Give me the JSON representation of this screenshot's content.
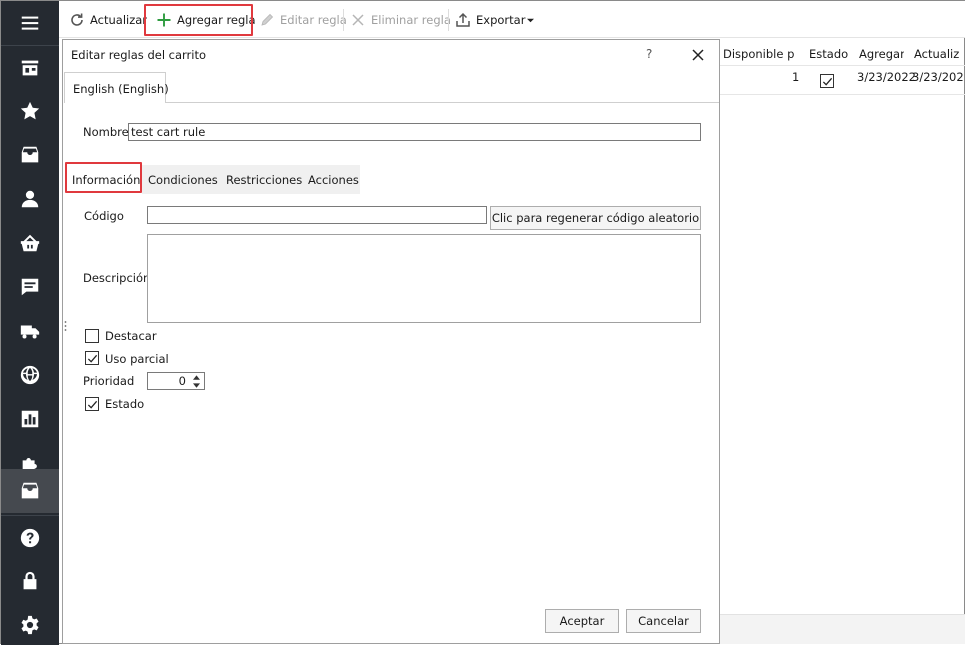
{
  "toolbar": {
    "refresh": "Actualizar",
    "add_rule": "Agregar regla",
    "edit_rule": "Editar regla",
    "delete_rule": "Eliminar regla",
    "export": "Exportar"
  },
  "grid": {
    "columns": [
      "Disponible pc",
      "Estado",
      "Agregar",
      "Actualiz"
    ],
    "row": {
      "available": "1",
      "added": "3/23/2022",
      "updated": "3/23/202"
    }
  },
  "dialog": {
    "title": "Editar reglas del carrito",
    "help": "?",
    "language_tab": "English (English)",
    "name_label": "Nombre",
    "name_value": "test cart rule",
    "tabs": [
      "Información",
      "Condiciones",
      "Restricciones",
      "Acciones"
    ],
    "code_label": "Código",
    "code_value": "",
    "regen_button": "Clic para regenerar código aleatorio",
    "description_label": "Descripción",
    "highlight_label": "Destacar",
    "partial_use_label": "Uso parcial",
    "priority_label": "Prioridad",
    "priority_value": "0",
    "status_label": "Estado",
    "ok_button": "Aceptar",
    "cancel_button": "Cancelar"
  },
  "colors": {
    "sidebar": "#252a31",
    "highlight": "#e0393e",
    "add_icon": "#2e9b3f"
  }
}
